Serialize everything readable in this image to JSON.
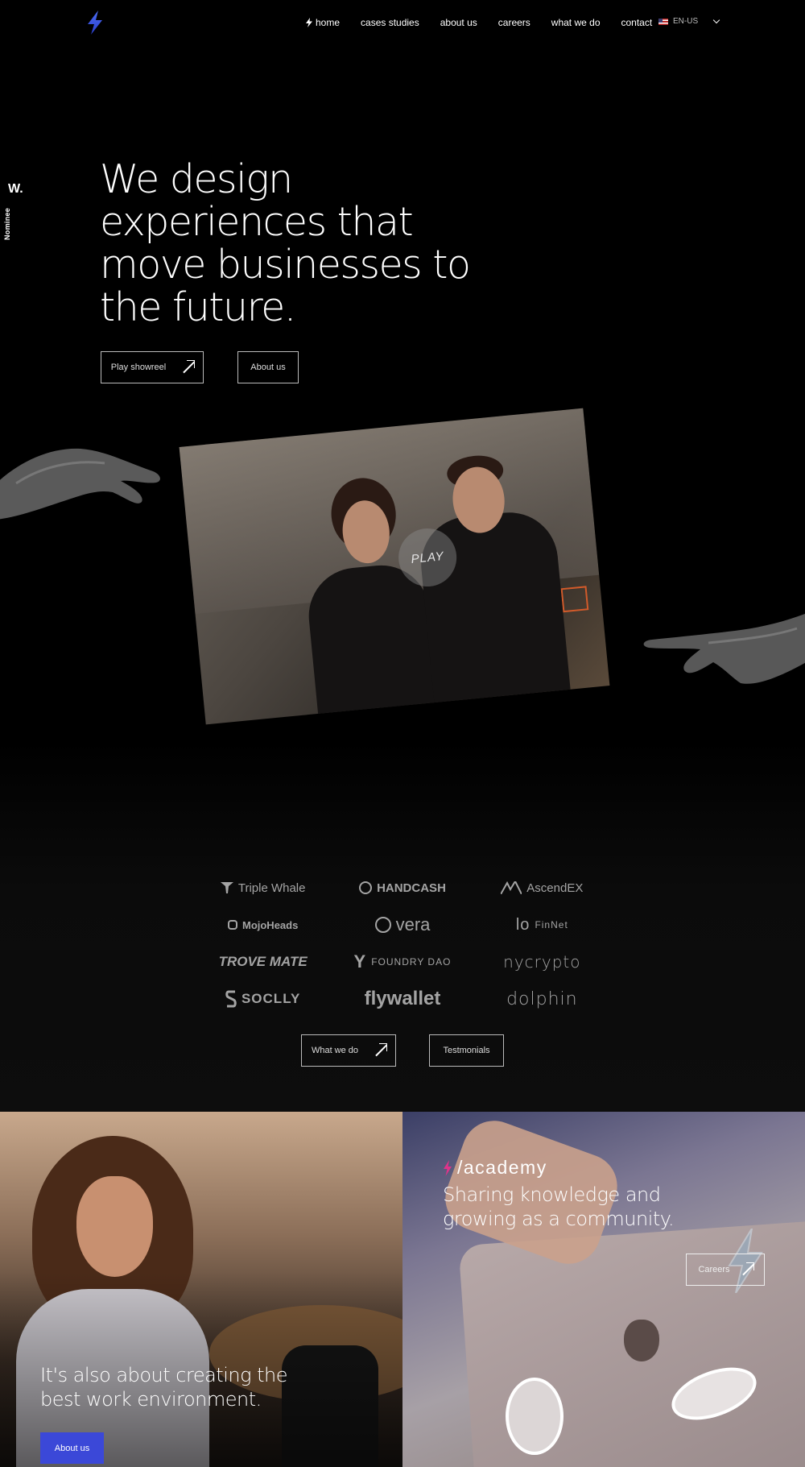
{
  "nav": {
    "items": [
      {
        "label": "home",
        "active": true
      },
      {
        "label": "cases studies"
      },
      {
        "label": "about us"
      },
      {
        "label": "careers"
      },
      {
        "label": "what we do"
      },
      {
        "label": "contact"
      }
    ],
    "language": "EN-US"
  },
  "award": {
    "mark": "W.",
    "label": "Nominee"
  },
  "hero": {
    "title": "We design experiences that move businesses to the future.",
    "buttons": {
      "showreel": "Play showreel",
      "about": "About us"
    },
    "play_label": "PLAY"
  },
  "clients": {
    "logos": [
      "Triple Whale",
      "HANDCASH",
      "AscendEX",
      "MojoHeads",
      "vera",
      "FinNet",
      "TROVE MATE",
      "FOUNDRY DAO",
      "nycrypto",
      "SOCLLY",
      "flywallet",
      "dolphin"
    ],
    "buttons": {
      "what_we_do": "What we do",
      "testimonials": "Testmonials"
    }
  },
  "environment": {
    "text": "It's also about creating the best work environment.",
    "button": "About us"
  },
  "academy": {
    "title": "/academy",
    "text": "Sharing knowledge and growing as a community.",
    "button": "Careers"
  },
  "colors": {
    "accent_blue": "#3b48d8",
    "academy_pink": "#e0338a",
    "background": "#000000"
  }
}
